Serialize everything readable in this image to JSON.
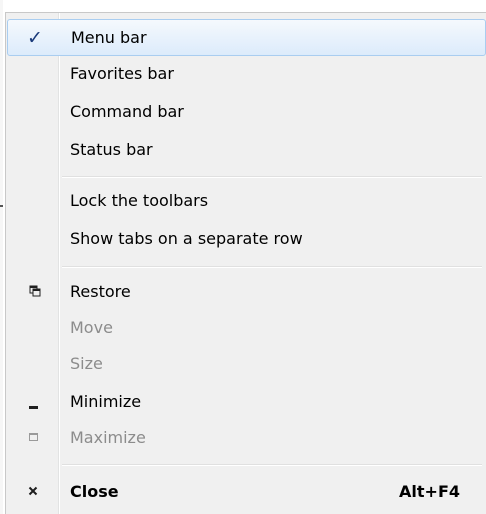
{
  "menu": {
    "items": [
      {
        "label": "Menu bar",
        "checked": true,
        "highlighted": true
      },
      {
        "label": "Favorites bar"
      },
      {
        "label": "Command bar"
      },
      {
        "label": "Status bar"
      },
      {
        "label": "Lock the toolbars"
      },
      {
        "label": "Show tabs on a separate row"
      },
      {
        "label": "Restore",
        "icon": "restore-icon"
      },
      {
        "label": "Move",
        "disabled": true
      },
      {
        "label": "Size",
        "disabled": true
      },
      {
        "label": "Minimize",
        "icon": "minimize-icon"
      },
      {
        "label": "Maximize",
        "icon": "maximize-icon",
        "disabled": true
      },
      {
        "label": "Close",
        "icon": "close-icon",
        "shortcut": "Alt+F4"
      }
    ],
    "check_glyph": "✓",
    "colors": {
      "highlight_border": "#a9cdf0",
      "check": "#1a3a7a",
      "disabled_text": "#8c8c8c"
    }
  }
}
